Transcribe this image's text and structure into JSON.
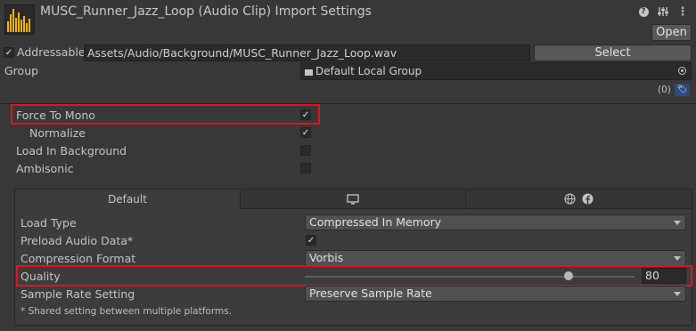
{
  "header": {
    "title": "MUSC_Runner_Jazz_Loop (Audio Clip) Import Settings",
    "open_label": "Open"
  },
  "addressable": {
    "checked": true,
    "label": "Addressable",
    "path": "Assets/Audio/Background/MUSC_Runner_Jazz_Loop.wav",
    "select_label": "Select"
  },
  "group": {
    "label": "Group",
    "value": "Default Local Group",
    "labels_count": "(0)"
  },
  "options": [
    {
      "label": "Force To Mono",
      "checked": true
    },
    {
      "label": "Normalize",
      "checked": true
    },
    {
      "label": "Load In Background",
      "checked": false
    },
    {
      "label": "Ambisonic",
      "checked": false
    }
  ],
  "platform_tabs": {
    "default_label": "Default"
  },
  "settings": {
    "load_type_label": "Load Type",
    "load_type_value": "Compressed In Memory",
    "preload_label": "Preload Audio Data*",
    "preload_checked": true,
    "compression_label": "Compression Format",
    "compression_value": "Vorbis",
    "quality_label": "Quality",
    "quality_value": "80",
    "quality_fraction": 0.8,
    "sample_rate_label": "Sample Rate Setting",
    "sample_rate_value": "Preserve Sample Rate",
    "footnote": "* Shared setting between multiple platforms."
  },
  "colors": {
    "highlight": "#e8101a",
    "waveform": "#f0b400",
    "tag": "#2d4a7a"
  }
}
